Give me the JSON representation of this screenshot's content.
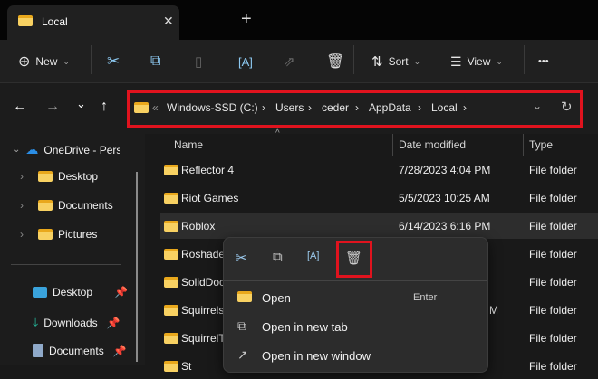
{
  "tab": {
    "title": "Local",
    "close": "✕",
    "new_tab": "+"
  },
  "toolbar": {
    "new_label": "New",
    "sort_label": "Sort",
    "view_label": "View",
    "more": "•••"
  },
  "nav": {
    "back": "←",
    "forward": "→",
    "recent": "⌄",
    "up": "↑"
  },
  "address": {
    "overflow": "«",
    "crumbs": [
      "Windows-SSD (C:)",
      "Users",
      "ceder",
      "AppData",
      "Local"
    ],
    "sep": "›",
    "dropdown": "⌄",
    "refresh": "↻"
  },
  "sidebar": {
    "onedrive": "OneDrive - Perso",
    "onedrive_items": [
      "Desktop",
      "Documents",
      "Pictures"
    ],
    "quick": [
      "Desktop",
      "Downloads",
      "Documents"
    ]
  },
  "columns": {
    "name": "Name",
    "date": "Date modified",
    "type": "Type"
  },
  "rows": [
    {
      "name": "Reflector 4",
      "date": "7/28/2023 4:04 PM",
      "type": "File folder"
    },
    {
      "name": "Riot Games",
      "date": "5/5/2023 10:25 AM",
      "type": "File folder"
    },
    {
      "name": "Roblox",
      "date": "6/14/2023 6:16 PM",
      "type": "File folder"
    },
    {
      "name": "Roshade",
      "date": "",
      "type": "File folder"
    },
    {
      "name": "SolidDoc",
      "date": "",
      "type": "File folder"
    },
    {
      "name": "Squirrels",
      "date": "M",
      "type": "File folder"
    },
    {
      "name": "SquirrelT",
      "date": "",
      "type": "File folder"
    },
    {
      "name": "St",
      "date": "",
      "type": "File folder"
    }
  ],
  "context_menu": {
    "items": [
      {
        "label": "Open",
        "shortcut": "Enter"
      },
      {
        "label": "Open in new tab"
      },
      {
        "label": "Open in new window"
      }
    ]
  }
}
